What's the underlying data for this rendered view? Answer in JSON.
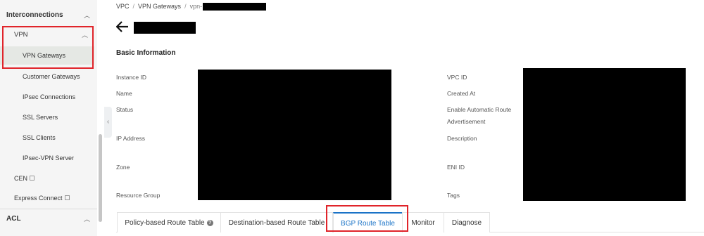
{
  "sidebar": {
    "interconnections": {
      "label": "Interconnections"
    },
    "vpn": {
      "label": "VPN"
    },
    "vpn_items": [
      {
        "label": "VPN Gateways"
      },
      {
        "label": "Customer Gateways"
      },
      {
        "label": "IPsec Connections"
      },
      {
        "label": "SSL Servers"
      },
      {
        "label": "SSL Clients"
      },
      {
        "label": "IPsec-VPN Server"
      }
    ],
    "cen": {
      "label": "CEN"
    },
    "express_connect": {
      "label": "Express Connect"
    },
    "acl": {
      "label": "ACL"
    },
    "icons": {
      "chevron": "chevron-up-icon",
      "external": "external-link-icon",
      "collapse": "chevron-left-icon"
    }
  },
  "breadcrumb": {
    "items": [
      "VPC",
      "VPN Gateways",
      "vpn-"
    ],
    "separator": "/"
  },
  "header": {
    "back_icon": "arrow-left-icon"
  },
  "basic_info": {
    "title": "Basic Information",
    "left_labels": {
      "instance_id": "Instance ID",
      "name": "Name",
      "status": "Status",
      "ip_address": "IP Address",
      "zone": "Zone",
      "resource_group": "Resource Group"
    },
    "right_labels": {
      "vpc_id": "VPC ID",
      "created_at": "Created At",
      "enable_auto_route_line1": "Enable Automatic Route",
      "enable_auto_route_line2": "Advertisement",
      "description": "Description",
      "eni_id": "ENI ID",
      "tags": "Tags"
    }
  },
  "tabs": [
    {
      "label": "Policy-based Route Table"
    },
    {
      "label": "Destination-based Route Table"
    },
    {
      "label": "BGP Route Table"
    },
    {
      "label": "Monitor"
    },
    {
      "label": "Diagnose"
    }
  ],
  "colors": {
    "accent": "#1a73c7",
    "highlight": "#e0242a",
    "sidebar_bg": "#f5f5f5"
  }
}
